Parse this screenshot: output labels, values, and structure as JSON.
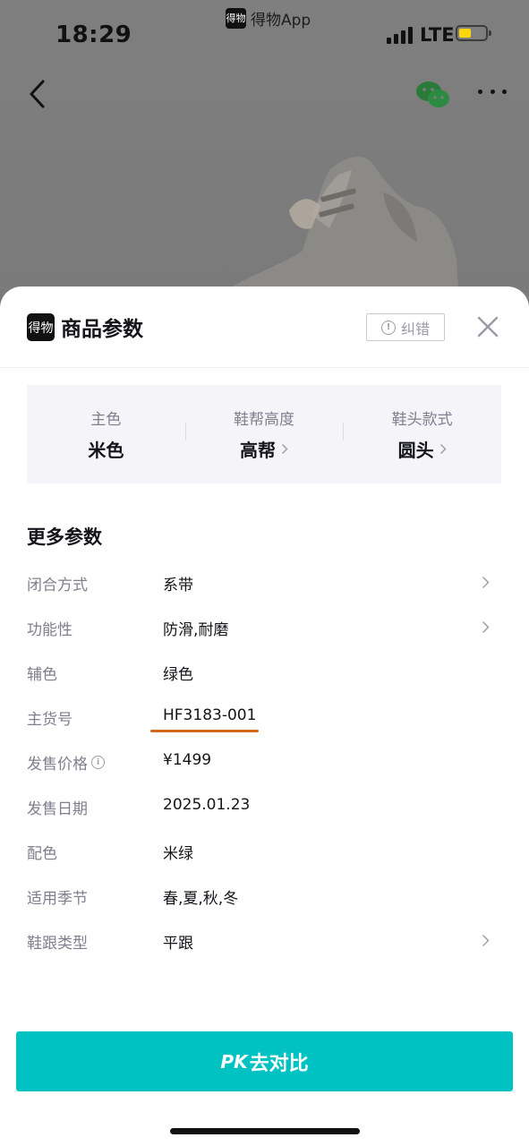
{
  "status_bar": {
    "time": "18:29",
    "source_app": "得物App",
    "source_logo_text": "得物",
    "network": "LTE",
    "battery_color": "#ffd60a"
  },
  "nav": {
    "back_icon": "chevron-left-icon",
    "share_icon": "wechat-icon",
    "more_icon": "more-dots-icon"
  },
  "sheet": {
    "logo_text": "得物",
    "title": "商品参数",
    "report_label": "纠错",
    "close_icon": "close-icon",
    "key_attributes": [
      {
        "label": "主色",
        "value": "米色",
        "has_arrow": false
      },
      {
        "label": "鞋帮高度",
        "value": "高帮",
        "has_arrow": true
      },
      {
        "label": "鞋头款式",
        "value": "圆头",
        "has_arrow": true
      }
    ],
    "more_title": "更多参数",
    "params": [
      {
        "label": "闭合方式",
        "value": "系带",
        "has_arrow": true
      },
      {
        "label": "功能性",
        "value": "防滑,耐磨",
        "has_arrow": true
      },
      {
        "label": "辅色",
        "value": "绿色",
        "has_arrow": false
      },
      {
        "label": "主货号",
        "value": "HF3183-001",
        "has_arrow": false,
        "highlighted": true
      },
      {
        "label": "发售价格",
        "value": "¥1499",
        "has_arrow": false,
        "has_info": true
      },
      {
        "label": "发售日期",
        "value": "2025.01.23",
        "has_arrow": false
      },
      {
        "label": "配色",
        "value": "米绿",
        "has_arrow": false
      },
      {
        "label": "适用季节",
        "value": "春,夏,秋,冬",
        "has_arrow": false
      },
      {
        "label": "鞋跟类型",
        "value": "平跟",
        "has_arrow": true
      }
    ],
    "pk_prefix": "PK",
    "pk_label": "去对比"
  },
  "colors": {
    "accent": "#01c2c3",
    "highlight_underline": "#d2691e",
    "overlay": "#808080"
  }
}
